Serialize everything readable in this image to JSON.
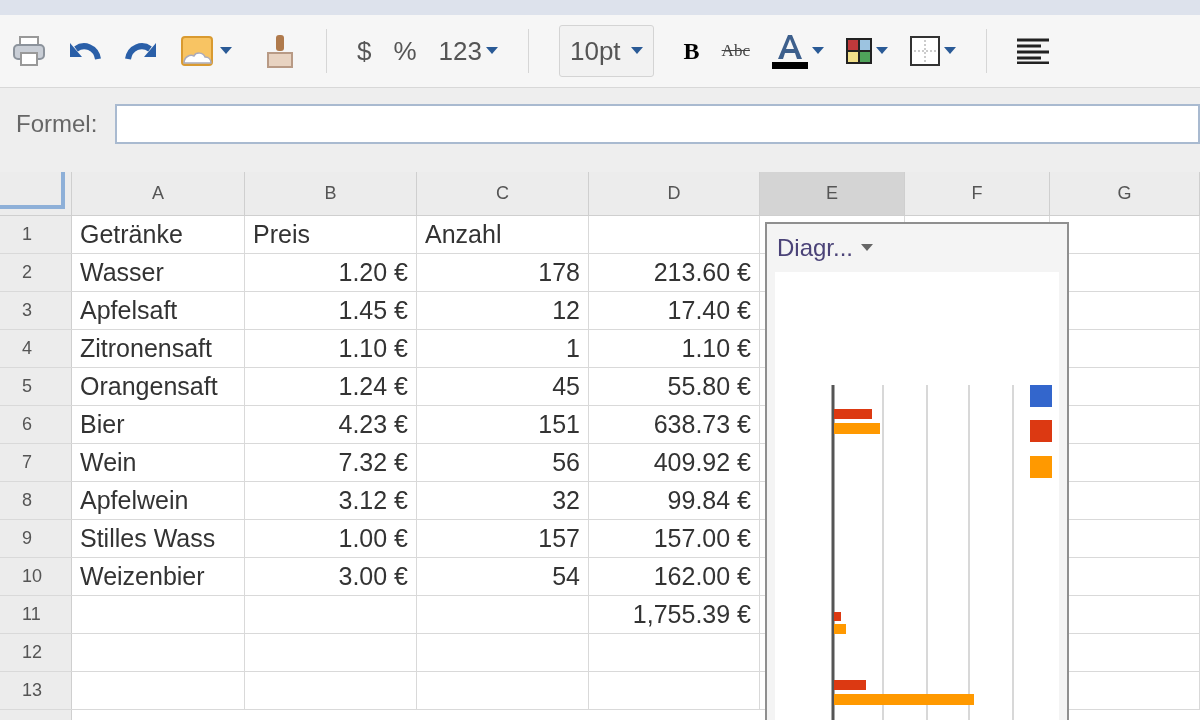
{
  "toolbar": {
    "currency": "$",
    "percent": "%",
    "number_format": "123",
    "font_size": "10pt",
    "bold": "B",
    "strikethrough": "Abc"
  },
  "formula_bar": {
    "label": "Formel:"
  },
  "columns": [
    {
      "label": "A",
      "selected": false
    },
    {
      "label": "B",
      "selected": false
    },
    {
      "label": "C",
      "selected": false
    },
    {
      "label": "D",
      "selected": false
    },
    {
      "label": "E",
      "selected": true
    },
    {
      "label": "F",
      "selected": false
    },
    {
      "label": "G",
      "selected": false
    }
  ],
  "rows": [
    {
      "number": "1",
      "kind": "header",
      "cells": {
        "A": "Getränke",
        "B": "Preis",
        "C": "Anzahl"
      }
    },
    {
      "number": "2",
      "kind": "data",
      "cells": {
        "A": "Wasser",
        "B": "1.20 €",
        "C": "178",
        "D": "213.60 €"
      }
    },
    {
      "number": "3",
      "kind": "data",
      "cells": {
        "A": "Apfelsaft",
        "B": "1.45 €",
        "C": "12",
        "D": "17.40 €"
      }
    },
    {
      "number": "4",
      "kind": "data",
      "cells": {
        "A": "Zitronensaft",
        "B": "1.10 €",
        "C": "1",
        "D": "1.10 €"
      }
    },
    {
      "number": "5",
      "kind": "data",
      "cells": {
        "A": "Orangensaft",
        "B": "1.24 €",
        "C": "45",
        "D": "55.80 €"
      }
    },
    {
      "number": "6",
      "kind": "data",
      "cells": {
        "A": "Bier",
        "B": "4.23 €",
        "C": "151",
        "D": "638.73 €"
      }
    },
    {
      "number": "7",
      "kind": "data",
      "cells": {
        "A": "Wein",
        "B": "7.32 €",
        "C": "56",
        "D": "409.92 €"
      }
    },
    {
      "number": "8",
      "kind": "data",
      "cells": {
        "A": "Apfelwein",
        "B": "3.12 €",
        "C": "32",
        "D": "99.84 €"
      }
    },
    {
      "number": "9",
      "kind": "data",
      "cells": {
        "A": "Stilles Wass",
        "B": "1.00 €",
        "C": "157",
        "D": "157.00 €"
      }
    },
    {
      "number": "10",
      "kind": "data",
      "cells": {
        "A": "Weizenbier",
        "B": "3.00 €",
        "C": "54",
        "D": "162.00 €"
      }
    },
    {
      "number": "11",
      "kind": "data",
      "cells": {
        "D": "1,755.39 €"
      }
    },
    {
      "number": "12",
      "kind": "data",
      "cells": {}
    },
    {
      "number": "13",
      "kind": "data",
      "cells": {}
    }
  ],
  "chart": {
    "title": "Diagr..."
  }
}
